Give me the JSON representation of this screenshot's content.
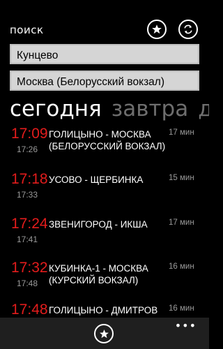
{
  "header": {
    "title": "поиск",
    "favorite_icon": "star-icon",
    "swap_icon": "swap-icon"
  },
  "search": {
    "from_value": "Кунцево",
    "to_value": "Москва (Белорусский вокзал)"
  },
  "pivot": {
    "items": [
      "сегодня",
      "завтра",
      "д"
    ],
    "active_index": 0
  },
  "schedule": [
    {
      "departure": "17:09",
      "arrival": "17:26",
      "route": "Голицыно - Москва (Белорусский вокзал)",
      "duration": "17 мин"
    },
    {
      "departure": "17:18",
      "arrival": "17:33",
      "route": "Усово - Щербинка",
      "duration": "15 мин"
    },
    {
      "departure": "17:24",
      "arrival": "17:41",
      "route": "Звенигород - Икша",
      "duration": "17 мин"
    },
    {
      "departure": "17:32",
      "arrival": "17:48",
      "route": "Кубинка-1 - Москва (Курский вокзал)",
      "duration": "16 мин"
    },
    {
      "departure": "17:48",
      "arrival": "",
      "route": "Голицыно - Дмитров",
      "duration": "16 мин"
    }
  ],
  "appbar": {
    "favorite_icon": "star-icon",
    "more_label": "•••"
  },
  "colors": {
    "background": "#000000",
    "accent_departure": "#e31c1c",
    "field_background": "#d5d5d5",
    "appbar": "#1f1f1f"
  }
}
